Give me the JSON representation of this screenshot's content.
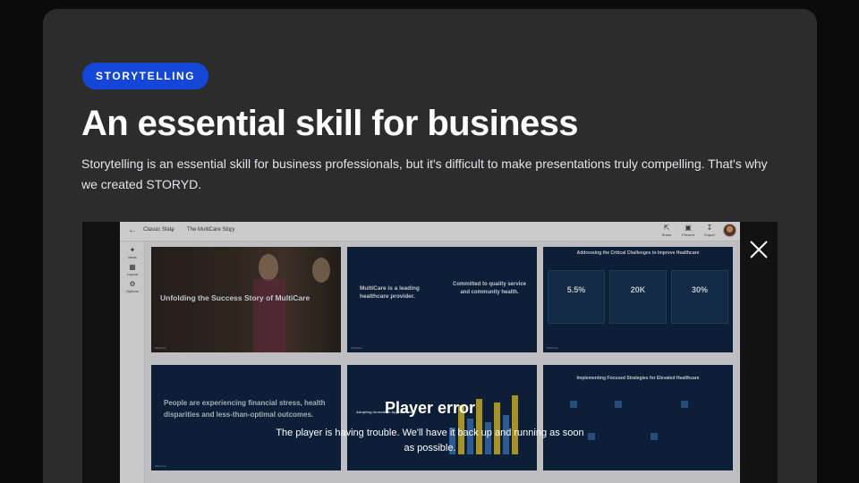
{
  "section": {
    "badge": "STORYTELLING",
    "headline": "An essential skill for business",
    "lede": "Storytelling is an essential skill for business professionals, but it's difficult to make presentations truly compelling. That's why we created STORYD."
  },
  "colors": {
    "page_bg": "#0b0b0c",
    "card_bg": "#2c2c2d",
    "badge_bg": "#1446d8",
    "slide_bg": "#0f2744",
    "bar_yellow": "#c9b23a",
    "bar_blue": "#3b6fb0"
  },
  "app": {
    "breadcrumb": [
      "Classic Slate",
      "The MultiCare Story"
    ],
    "actions": [
      {
        "icon": "share-icon",
        "label": "Share"
      },
      {
        "icon": "present-icon",
        "label": "Present"
      },
      {
        "icon": "export-icon",
        "label": "Export"
      }
    ],
    "rail": [
      {
        "icon": "sparkle-icon",
        "label": "Ideas"
      },
      {
        "icon": "layout-icon",
        "label": "Layout"
      },
      {
        "icon": "gear-icon",
        "label": "Options"
      }
    ],
    "slides": [
      {
        "title": "Unfolding the Success Story of MultiCare",
        "caption_left": "Opening",
        "caption_right": "Slide 1"
      },
      {
        "title": "MultiCare is a leading healthcare provider.",
        "title2": "Committed to quality service and community health.",
        "caption_left": "Context",
        "caption_right": "Slide 2"
      },
      {
        "title": "Addressing the Critical Challenges to Improve Healthcare",
        "stats": [
          "5.5%",
          "20K",
          "30%"
        ],
        "caption_left": "Offices",
        "caption_right": "Slide 3"
      },
      {
        "title": "People are experiencing financial stress, health disparities and less-than-optimal outcomes.",
        "caption_left": "",
        "caption_right": "Slide 4"
      },
      {
        "title": "Adopting Innovative Approaches",
        "caption_left": "",
        "caption_right": "Slide 5"
      },
      {
        "title": "Implementing Focused Strategies for Elevated Healthcare",
        "caption_left": "",
        "caption_right": "Slide 6"
      }
    ]
  },
  "player": {
    "error_title": "Player error",
    "error_message": "The player is having trouble. We'll have it back up and running as soon as possible."
  }
}
